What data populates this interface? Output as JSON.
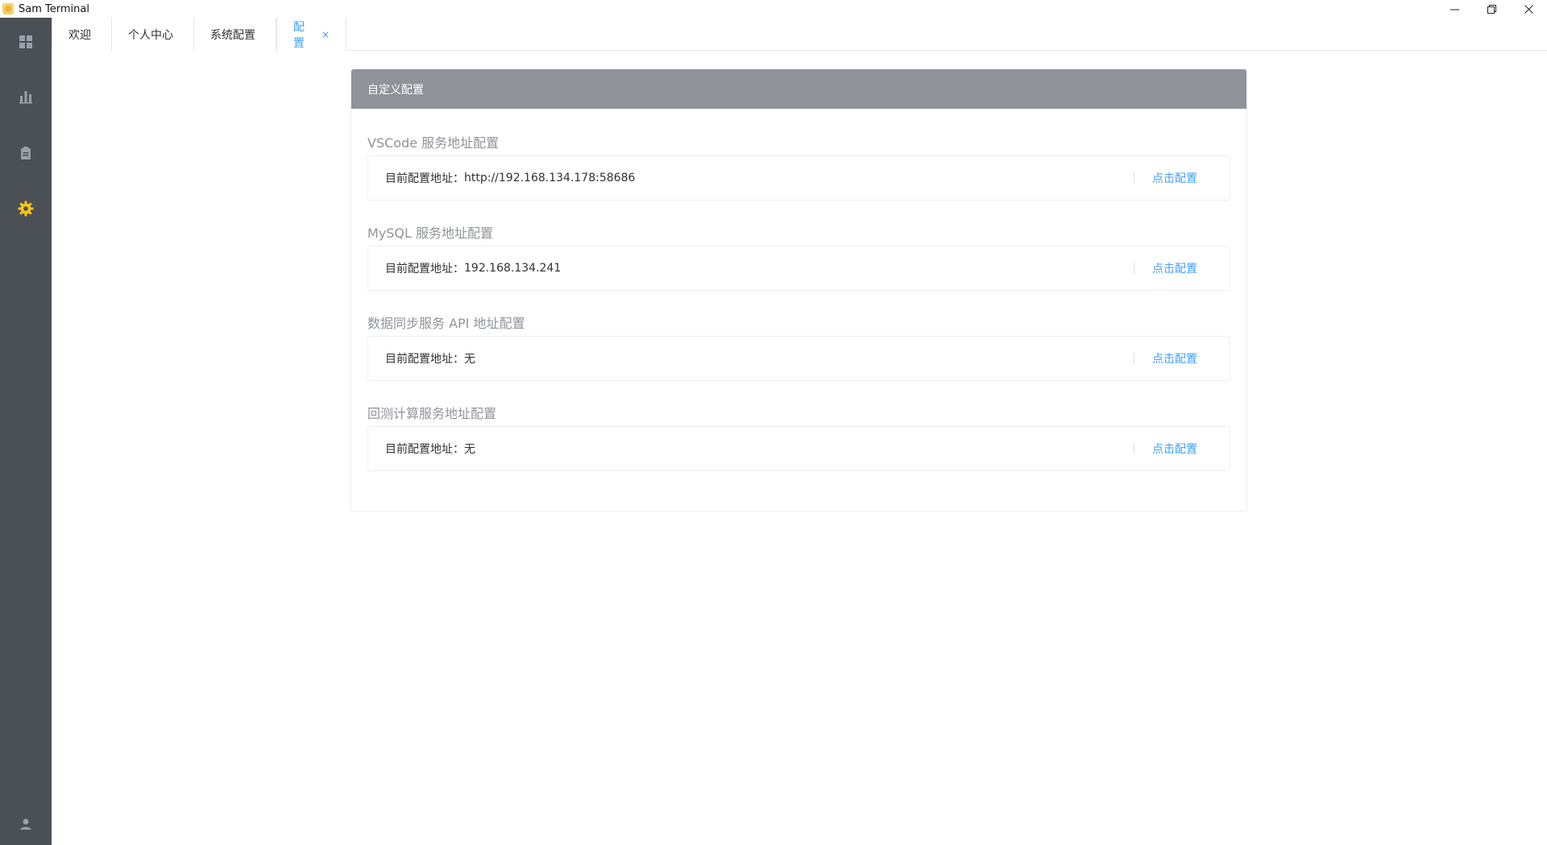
{
  "window": {
    "title": "Sam Terminal",
    "controls": {
      "minimize_icon": "minimize-icon",
      "restore_icon": "restore-icon",
      "close_icon": "close-icon"
    }
  },
  "sidebar": {
    "bg_color": "#4b4f56",
    "active_color": "#f5c518",
    "items": [
      {
        "icon": "dashboard-grid-icon",
        "active": false
      },
      {
        "icon": "bar-chart-icon",
        "active": false
      },
      {
        "icon": "clipboard-icon",
        "active": false
      },
      {
        "icon": "gear-icon",
        "active": true
      }
    ],
    "bottom_icon": "user-icon"
  },
  "tabs": [
    {
      "label": "欢迎",
      "active": false
    },
    {
      "label": "个人中心",
      "active": false
    },
    {
      "label": "系统配置",
      "active": false
    },
    {
      "label": "配置",
      "active": true,
      "close": "×"
    }
  ],
  "card": {
    "header": "自定义配置",
    "sections": [
      {
        "title": "VSCode 服务地址配置",
        "label": "目前配置地址：",
        "value": "http://192.168.134.178:58686",
        "action": "点击配置"
      },
      {
        "title": "MySQL 服务地址配置",
        "label": "目前配置地址：",
        "value": "192.168.134.241",
        "action": "点击配置"
      },
      {
        "title": "数据同步服务 API 地址配置",
        "label": "目前配置地址：",
        "value": "无",
        "action": "点击配置"
      },
      {
        "title": "回测计算服务地址配置",
        "label": "目前配置地址：",
        "value": "无",
        "action": "点击配置"
      }
    ]
  },
  "colors": {
    "accent": "#409eff",
    "card_header_bg": "#909399",
    "section_title": "#909399"
  }
}
